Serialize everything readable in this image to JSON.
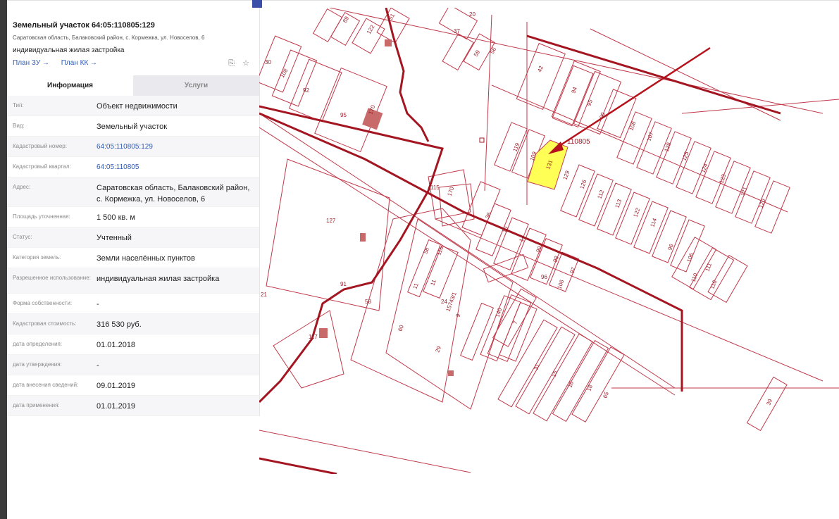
{
  "header": {
    "title": "Земельный участок 64:05:110805:129",
    "address": "Саратовская область, Балаковский район, с. Кормежка, ул. Новоселов, 6",
    "use": "индивидуальная жилая застройка",
    "link_zu": "План ЗУ →",
    "link_kk": "План КК →"
  },
  "tabs": {
    "info": "Информация",
    "services": "Услуги"
  },
  "rows": [
    {
      "label": "Тип:",
      "value": "Объект недвижимости"
    },
    {
      "label": "Вид:",
      "value": "Земельный участок"
    },
    {
      "label": "Кадастровый номер:",
      "value": "64:05:110805:129"
    },
    {
      "label": "Кадастровый квартал:",
      "value": "64:05:110805"
    },
    {
      "label": "Адрес:",
      "value": "Саратовская область, Балаковский район, с. Кормежка, ул. Новоселов, 6"
    },
    {
      "label": "Площадь уточненная:",
      "value": "1 500 кв. м"
    },
    {
      "label": "Статус:",
      "value": "Учтенный"
    },
    {
      "label": "Категория земель:",
      "value": "Земли населённых пунктов"
    },
    {
      "label": "Разрешенное использование:",
      "value": "индивидуальная жилая застройка"
    },
    {
      "label": "Форма собственности:",
      "value": "-"
    },
    {
      "label": "Кадастровая стоимость:",
      "value": "316 530 руб."
    },
    {
      "label": "дата определения:",
      "value": "01.01.2018"
    },
    {
      "label": "дата утверждения:",
      "value": "-"
    },
    {
      "label": "дата внесения сведений:",
      "value": "09.01.2019"
    },
    {
      "label": "дата применения:",
      "value": "01.01.2019"
    }
  ],
  "map": {
    "block_label": "110805",
    "parcels": [
      "89",
      "122",
      "51",
      "20",
      "37",
      "59",
      "56",
      "30",
      "108",
      "92",
      "95",
      "42",
      "94",
      "95",
      "90",
      "108",
      "107",
      "128",
      "125",
      "124",
      "123",
      "121",
      "120",
      "119",
      "109",
      "131",
      "129",
      "126",
      "112",
      "113",
      "122",
      "114",
      "127",
      "115",
      "170",
      "36",
      "10",
      "14",
      "99",
      "98",
      "97",
      "96",
      "106",
      "96",
      "106",
      "111",
      "110",
      "116",
      "116",
      "58",
      "11",
      "11",
      "58",
      "24",
      "15743/1",
      "9",
      "140",
      "7",
      "117",
      "60",
      "29",
      "31",
      "15",
      "16",
      "18",
      "65",
      "39",
      "21",
      "91",
      "170",
      "33"
    ],
    "colors": {
      "line": "#c0394a",
      "thick": "#a31621",
      "highlight": "#ffff4d"
    }
  }
}
